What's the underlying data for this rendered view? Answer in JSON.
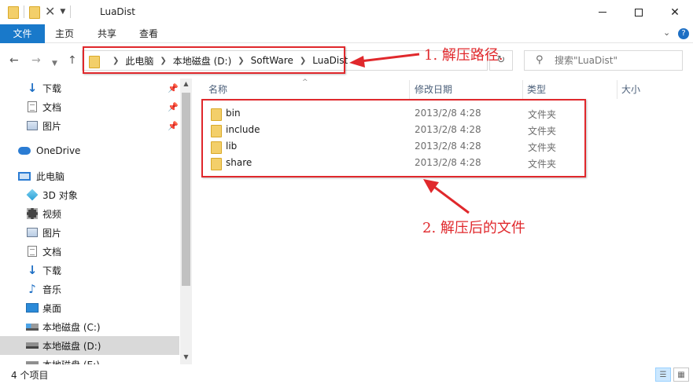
{
  "window": {
    "title": "LuaDist"
  },
  "ribbon": {
    "tabs": [
      "文件",
      "主页",
      "共享",
      "查看"
    ]
  },
  "address": {
    "crumbs": [
      "此电脑",
      "本地磁盘 (D:)",
      "SoftWare",
      "LuaDist"
    ],
    "search_placeholder": "搜索\"LuaDist\""
  },
  "nav": {
    "quick_access": [
      {
        "label": "下载",
        "icon": "download-icon",
        "pinned": true
      },
      {
        "label": "文档",
        "icon": "document-icon",
        "pinned": true
      },
      {
        "label": "图片",
        "icon": "picture-icon",
        "pinned": true
      }
    ],
    "onedrive": "OneDrive",
    "this_pc": "此电脑",
    "pc_items": [
      {
        "label": "3D 对象",
        "icon": "3d-objects-icon"
      },
      {
        "label": "视频",
        "icon": "video-icon"
      },
      {
        "label": "图片",
        "icon": "picture-icon"
      },
      {
        "label": "文档",
        "icon": "document-icon"
      },
      {
        "label": "下载",
        "icon": "download-icon"
      },
      {
        "label": "音乐",
        "icon": "music-icon"
      },
      {
        "label": "桌面",
        "icon": "desktop-icon"
      },
      {
        "label": "本地磁盘 (C:)",
        "icon": "drive-icon"
      },
      {
        "label": "本地磁盘 (D:)",
        "icon": "drive-icon",
        "selected": true
      },
      {
        "label": "本地磁盘 (E:)",
        "icon": "drive-icon"
      }
    ]
  },
  "columns": {
    "name": "名称",
    "date": "修改日期",
    "type": "类型",
    "size": "大小"
  },
  "files": [
    {
      "name": "bin",
      "date": "2013/2/8 4:28",
      "type": "文件夹"
    },
    {
      "name": "include",
      "date": "2013/2/8 4:28",
      "type": "文件夹"
    },
    {
      "name": "lib",
      "date": "2013/2/8 4:28",
      "type": "文件夹"
    },
    {
      "name": "share",
      "date": "2013/2/8 4:28",
      "type": "文件夹"
    }
  ],
  "annotations": {
    "path_note": "1. 解压路径.",
    "files_note": "2. 解压后的文件",
    "color": "#e0282c"
  },
  "status": {
    "item_count": "4 个项目"
  },
  "colors": {
    "file_tab": "#1979ca",
    "folder": "#f3cf6a",
    "selected_nav": "#d9d9d9"
  }
}
